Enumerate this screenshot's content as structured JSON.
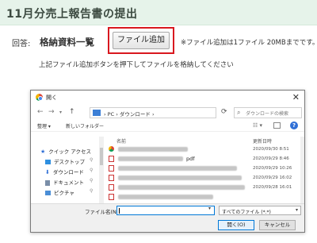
{
  "header": {
    "title": "11月分売上報告書の提出"
  },
  "form": {
    "answer_label": "回答:",
    "doc_label": "格納資料一覧",
    "add_button_label": "ファイル追加",
    "note": "※ファイル追加は1ファイル 20MBまでです。",
    "instruction": "上記ファイル追加ボタンを押下してファイルを格納してください"
  },
  "dialog": {
    "title": "開く",
    "close_icon": "close-icon",
    "path_pc": "PC",
    "path_folder": "ダウンロード",
    "search_placeholder": "ダウンロードの検索",
    "toolbar": {
      "organize": "整理 ▾",
      "new_folder": "新しいフォルダー"
    },
    "nav_items": [
      {
        "label": "クイック アクセス",
        "icon": "star-icon",
        "color": "#2f6fd6"
      },
      {
        "label": "デスクトップ",
        "icon": "desktop-icon",
        "color": "#2f8fe0"
      },
      {
        "label": "ダウンロード",
        "icon": "download-icon",
        "color": "#2f6fd6"
      },
      {
        "label": "ドキュメント",
        "icon": "document-icon",
        "color": "#7a8ea8"
      },
      {
        "label": "ピクチャ",
        "icon": "picture-icon",
        "color": "#4a8ed6"
      }
    ],
    "columns": {
      "name": "名前",
      "date": "更新日時"
    },
    "files": [
      {
        "icon": "chrome-file-icon",
        "suffix": "",
        "date": "2020/09/30 8:51"
      },
      {
        "icon": "pdf-icon",
        "suffix": "pdf",
        "date": "2020/09/29 8:46"
      },
      {
        "icon": "pdf-icon",
        "suffix": "",
        "date": "2020/09/29 10:26"
      },
      {
        "icon": "pdf-icon",
        "suffix": "",
        "date": "2020/09/29 16:02"
      },
      {
        "icon": "pdf-icon",
        "suffix": "",
        "date": "2020/09/28 16:01"
      },
      {
        "icon": "pdf-icon",
        "suffix": "",
        "date": ""
      }
    ],
    "filename_label": "ファイル名(N):",
    "filename_value": "",
    "file_type": "すべてのファイル (*.*)",
    "open_button": "開く(O)",
    "cancel_button": "キャンセル"
  }
}
